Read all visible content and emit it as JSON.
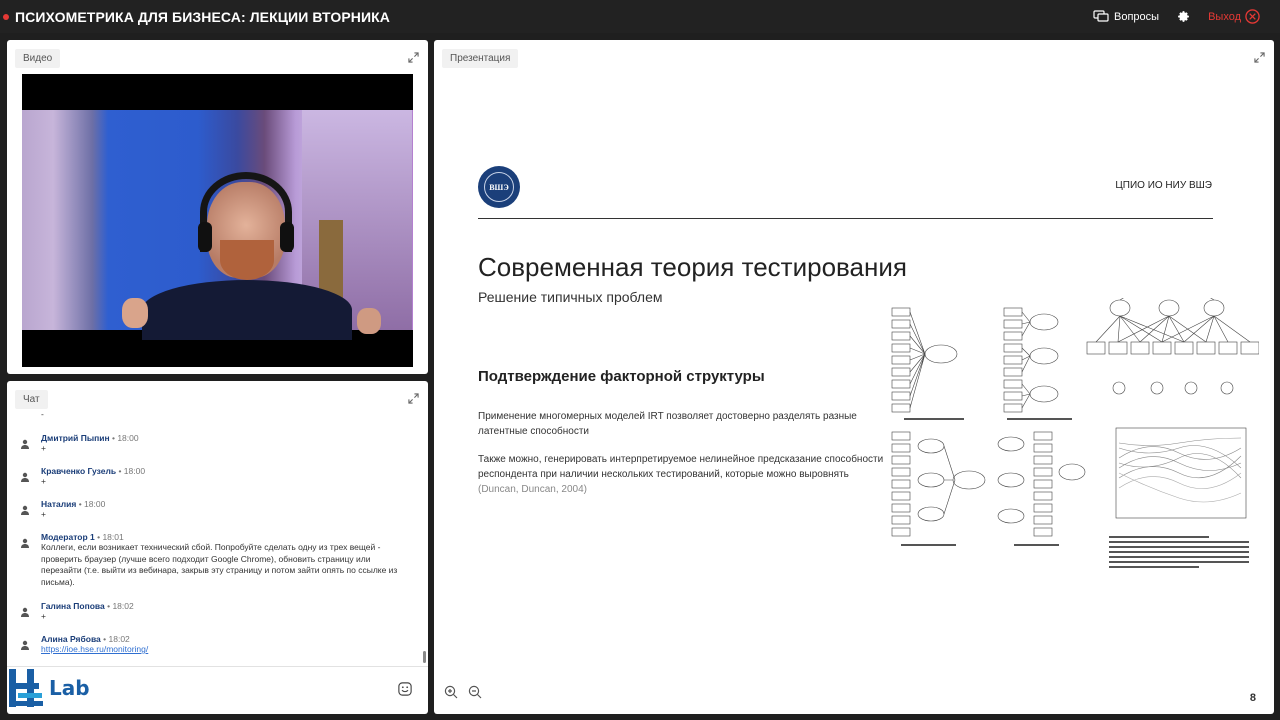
{
  "header": {
    "title": "ПСИХОМЕТРИКА ДЛЯ БИЗНЕСА: ЛЕКЦИИ ВТОРНИКА",
    "questions_label": "Вопросы",
    "exit_label": "Выход"
  },
  "video": {
    "tag": "Видео"
  },
  "chat": {
    "tag": "Чат",
    "top_fragment": "-",
    "messages": [
      {
        "author": "Дмитрий Пыпин",
        "time": "18:00",
        "text": "+"
      },
      {
        "author": "Кравченко Гузель",
        "time": "18:00",
        "text": "+"
      },
      {
        "author": "Наталия",
        "time": "18:00",
        "text": "+"
      },
      {
        "author": "Модератор 1",
        "time": "18:01",
        "text": "Коллеги, если возникает технический сбой. Попробуйте сделать одну из трех вещей - проверить браузер (лучше всего подходит Google Chrome), обновить страницу или перезайти (т.е. выйти из вебинара, закрыв эту страницу и потом зайти опять по ссылке из письма)."
      },
      {
        "author": "Галина Попова",
        "time": "18:02",
        "text": "+"
      },
      {
        "author": "Алина Рябова",
        "time": "18:02",
        "link": "https://ioe.hse.ru/monitoring/"
      }
    ]
  },
  "logo": {
    "text": "Lab"
  },
  "presentation": {
    "tag": "Презентация",
    "page_number": "8",
    "slide": {
      "logo_text": "ВШЭ",
      "org": "ЦПИО ИО НИУ ВШЭ",
      "title": "Современная теория тестирования",
      "subtitle": "Решение типичных проблем",
      "section": "Подтверждение факторной структуры",
      "para1": "Применение многомерных моделей IRT позволяет достоверно разделять разные латентные способности",
      "para2_main": "Также можно, генерировать интерпретируемое нелинейное предсказание способности респондента при наличии нескольких тестирований, которые можно выровнять",
      "para2_cite": "(Duncan, Duncan, 2004)"
    }
  }
}
